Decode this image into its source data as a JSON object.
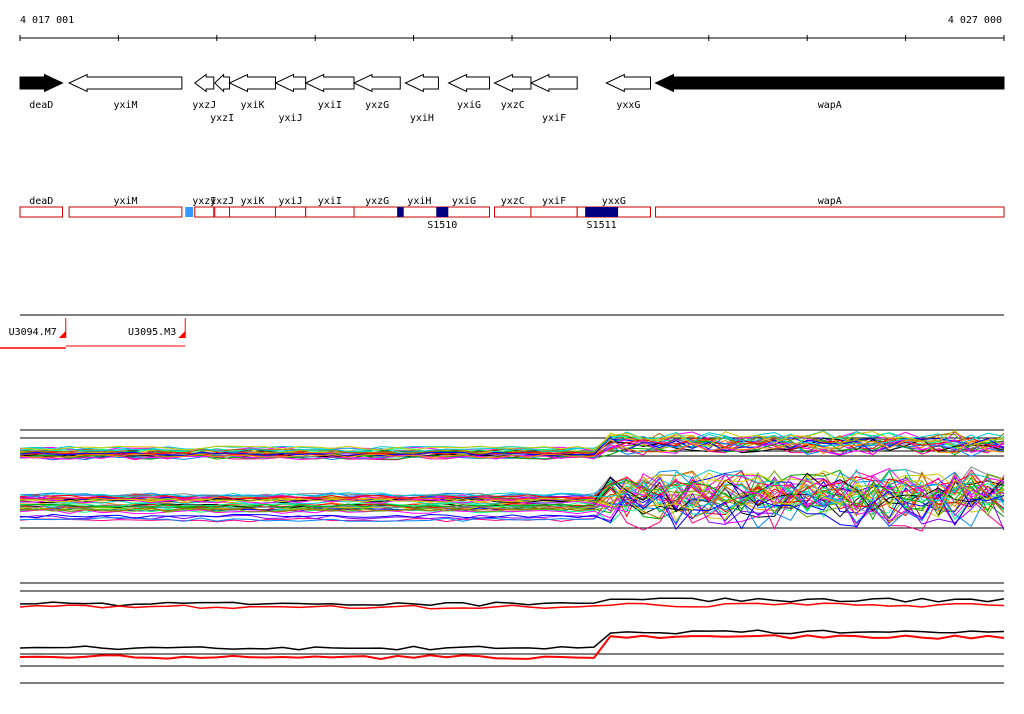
{
  "ruler": {
    "start_label": "4 017 001",
    "end_label": "4 027 000",
    "start": 4017001,
    "end": 4027000
  },
  "colors": {
    "gene_fill_forward": "#000000",
    "gene_outline": "#000000",
    "feature_outline": "#cc0000",
    "segment_dark": "#000080",
    "segment_light": "#3399ff",
    "marker_red": "#ff0000",
    "profile_black": "#000000",
    "profile_red": "#ff0000"
  },
  "genes": [
    {
      "name": "deaD",
      "start": 4017001,
      "end": 4017433,
      "strand": "+",
      "label_row": 0
    },
    {
      "name": "yxiM",
      "start": 4017500,
      "end": 4018646,
      "strand": "-",
      "label_row": 0
    },
    {
      "name": "yxzJ",
      "start": 4018777,
      "end": 4018970,
      "strand": "-",
      "label_row": 0
    },
    {
      "name": "yxzI",
      "start": 4018980,
      "end": 4019130,
      "strand": "-",
      "label_row": 1
    },
    {
      "name": "yxiK",
      "start": 4019130,
      "end": 4019597,
      "strand": "-",
      "label_row": 0
    },
    {
      "name": "yxiJ",
      "start": 4019597,
      "end": 4019904,
      "strand": "-",
      "label_row": 1
    },
    {
      "name": "yxiI",
      "start": 4019904,
      "end": 4020395,
      "strand": "-",
      "label_row": 0
    },
    {
      "name": "yxzG",
      "start": 4020395,
      "end": 4020865,
      "strand": "-",
      "label_row": 0
    },
    {
      "name": "yxiH",
      "start": 4020917,
      "end": 4021253,
      "strand": "-",
      "label_row": 1
    },
    {
      "name": "yxiG",
      "start": 4021356,
      "end": 4021772,
      "strand": "-",
      "label_row": 0
    },
    {
      "name": "yxzC",
      "start": 4021823,
      "end": 4022193,
      "strand": "-",
      "label_row": 0
    },
    {
      "name": "yxiF",
      "start": 4022193,
      "end": 4022663,
      "strand": "-",
      "label_row": 1
    },
    {
      "name": "yxxG",
      "start": 4022959,
      "end": 4023408,
      "strand": "-",
      "label_row": 0
    },
    {
      "name": "wapA",
      "start": 4023459,
      "end": 4027000,
      "strand": "-",
      "filled": true,
      "label_row": 0
    }
  ],
  "features": [
    {
      "name": "deaD",
      "start": 4017001,
      "end": 4017433
    },
    {
      "name": "yxiM",
      "start": 4017500,
      "end": 4018646
    },
    {
      "name": "yxzI",
      "start": 4018777,
      "end": 4018970
    },
    {
      "name": "yxzJ",
      "start": 4018980,
      "end": 4019130
    },
    {
      "name": "yxiK",
      "start": 4019130,
      "end": 4019597
    },
    {
      "name": "yxiJ",
      "start": 4019597,
      "end": 4019904
    },
    {
      "name": "yxiI",
      "start": 4019904,
      "end": 4020395
    },
    {
      "name": "yxzG",
      "start": 4020395,
      "end": 4020865
    },
    {
      "name": "yxiH",
      "start": 4020865,
      "end": 4021253
    },
    {
      "name": "yxiG",
      "start": 4021253,
      "end": 4021772
    },
    {
      "name": "yxzC",
      "start": 4021823,
      "end": 4022193
    },
    {
      "name": "yxiF",
      "start": 4022193,
      "end": 4022663
    },
    {
      "name": "yxxG",
      "start": 4022663,
      "end": 4023408
    },
    {
      "name": "wapA",
      "start": 4023459,
      "end": 4027000
    }
  ],
  "segments": [
    {
      "start": 4018680,
      "end": 4018760,
      "color": "light"
    },
    {
      "start": 4020833,
      "end": 4020900,
      "color": "dark"
    },
    {
      "start": 4021231,
      "end": 4021353,
      "color": "dark"
    },
    {
      "start": 4022744,
      "end": 4023078,
      "color": "dark"
    }
  ],
  "segment_labels": [
    {
      "text": "S1510",
      "pos": 4021292
    },
    {
      "text": "S1511",
      "pos": 4022911
    }
  ],
  "transcripts": [
    {
      "label": "U3094.M7",
      "end": 4017466
    },
    {
      "label": "U3095.M3",
      "end": 4018680
    }
  ]
}
